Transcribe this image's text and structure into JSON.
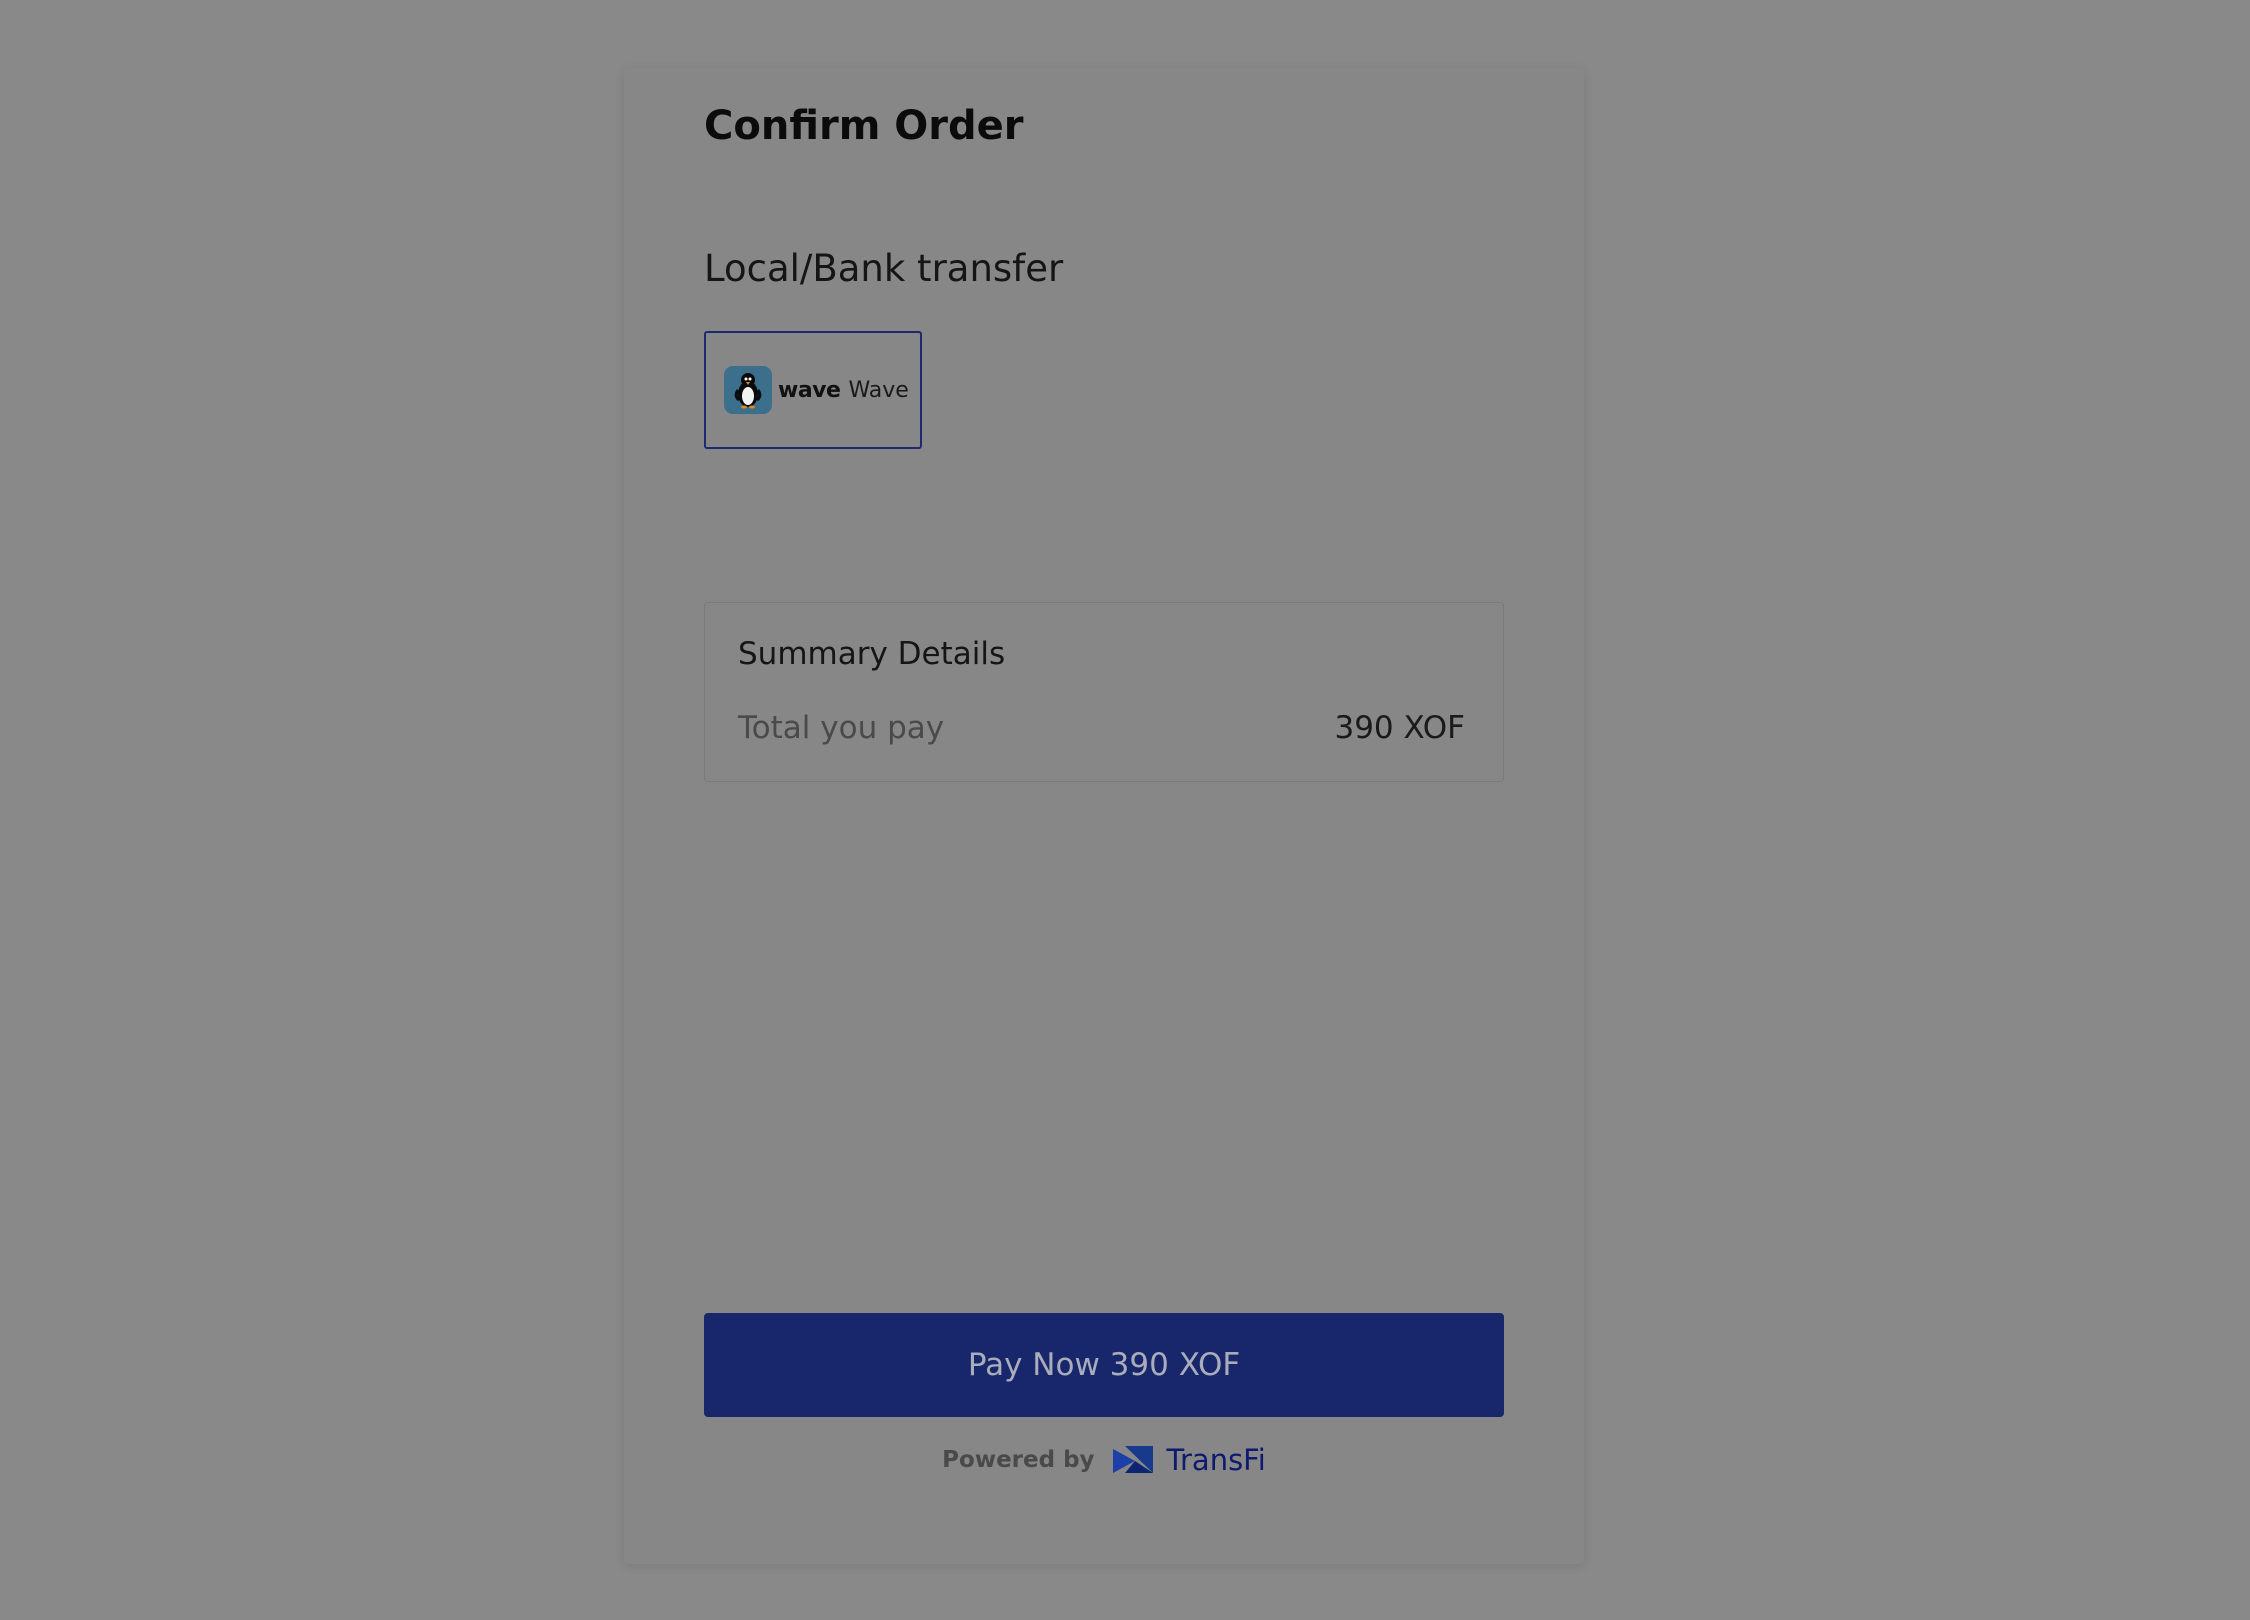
{
  "header": {
    "title": "Confirm Order"
  },
  "payment": {
    "section_title": "Local/Bank transfer",
    "selected_method": {
      "logo_wordmark": "wave",
      "label": "Wave",
      "logo_icon": "penguin-icon"
    }
  },
  "summary": {
    "title": "Summary Details",
    "total_label": "Total you pay",
    "total_value": "390 XOF"
  },
  "actions": {
    "pay_button_label": "Pay Now 390 XOF"
  },
  "footer": {
    "powered_by": "Powered by",
    "brand_name": "TransFi",
    "brand_icon": "transfi-logo-icon"
  },
  "colors": {
    "overlay_background": "#898989",
    "primary_button": "#18276b",
    "selected_border": "#1d2a70",
    "brand_text": "#0f1a6e"
  }
}
